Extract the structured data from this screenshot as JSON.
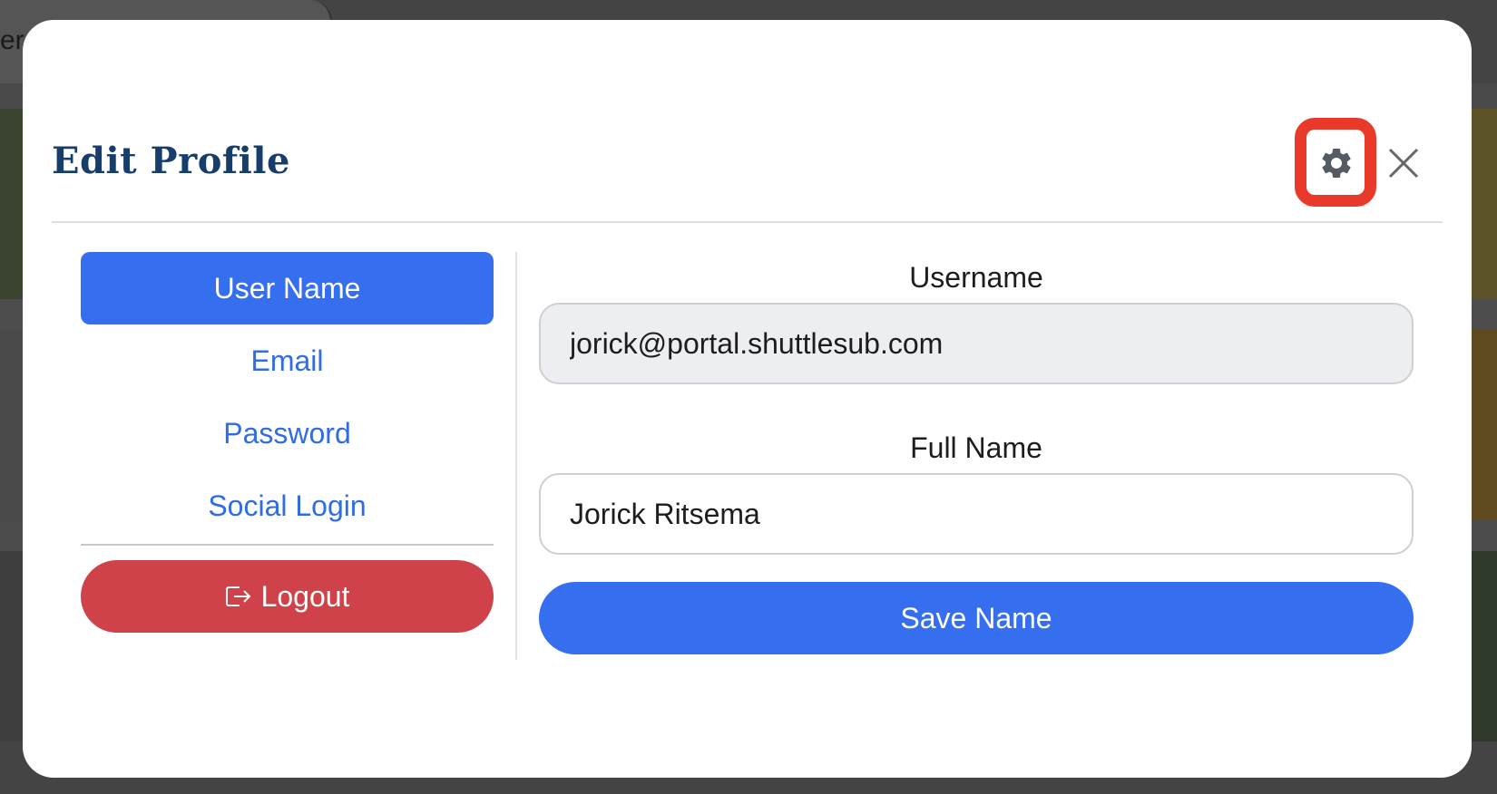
{
  "background": {
    "tab_text": "er"
  },
  "modal": {
    "title": "Edit Profile",
    "settings_icon": "gear-icon",
    "close_icon": "close-icon",
    "highlight_color": "#e8392a"
  },
  "nav": {
    "items": [
      {
        "label": "User Name",
        "active": true
      },
      {
        "label": "Email",
        "active": false
      },
      {
        "label": "Password",
        "active": false
      },
      {
        "label": "Social Login",
        "active": false
      }
    ],
    "logout_label": "Logout",
    "logout_icon": "logout-icon"
  },
  "form": {
    "username_label": "Username",
    "username_value": "jorick@portal.shuttlesub.com",
    "fullname_label": "Full Name",
    "fullname_value": "Jorick Ritsema",
    "save_label": "Save Name"
  },
  "colors": {
    "primary": "#356ff0",
    "danger": "#cf424a",
    "title": "#173d6b",
    "link": "#2f6ce6"
  }
}
